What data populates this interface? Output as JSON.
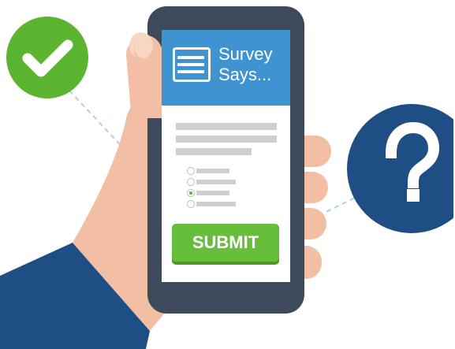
{
  "survey": {
    "title": "Survey\nSays...",
    "icon": "form-list-icon",
    "options": [
      {
        "selected": false
      },
      {
        "selected": false
      },
      {
        "selected": true
      },
      {
        "selected": false
      }
    ],
    "submit_label": "SUBMIT"
  },
  "badges": {
    "check_icon": "checkmark-icon",
    "question_icon": "question-mark-icon"
  },
  "colors": {
    "header_blue": "#3f93d1",
    "submit_green": "#67be3a",
    "check_green": "#5cb531",
    "question_navy": "#1f4e85",
    "phone_body": "#3d4a5c",
    "sleeve": "#1f4e85",
    "skin": "#f2bea4"
  }
}
